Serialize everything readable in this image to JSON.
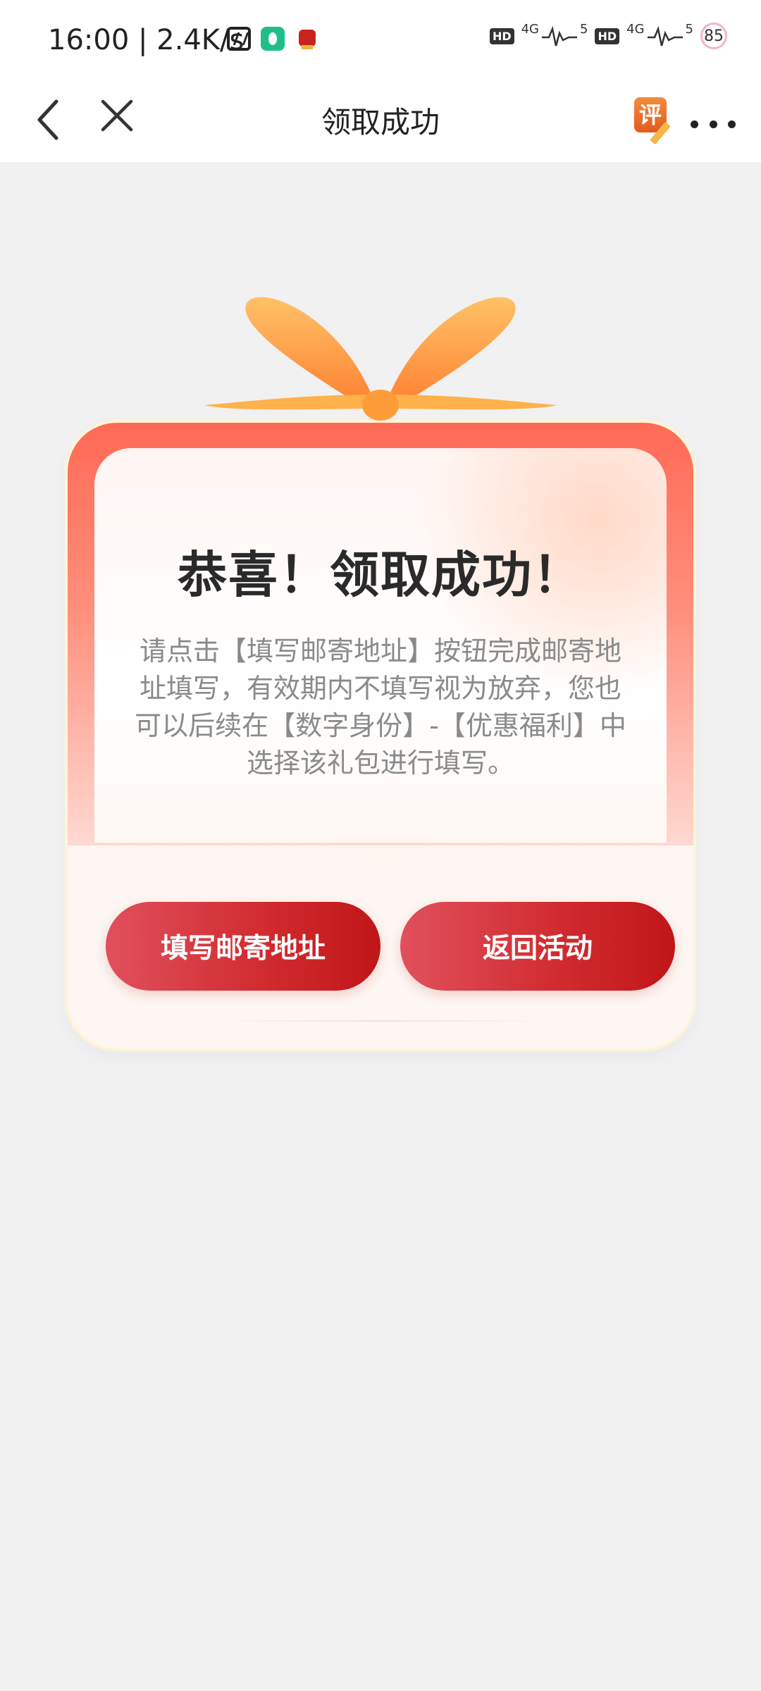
{
  "status_bar": {
    "time": "16:00 | 2.4K/s",
    "hd1": "HD",
    "signal1": "4G",
    "signal1_bars": "5",
    "hd2": "HD",
    "signal2": "4G",
    "signal2_bars": "5",
    "battery": "85"
  },
  "nav": {
    "title": "领取成功",
    "review_label": "评"
  },
  "card": {
    "title": "恭喜！领取成功！",
    "description": "请点击【填写邮寄地址】按钮完成邮寄地址填写，有效期内不填写视为放弃，您也可以后续在【数字身份】-【优惠福利】中选择该礼包进行填写。",
    "fill_address_button": "填写邮寄地址",
    "return_button": "返回活动"
  },
  "colors": {
    "button_start": "#e0505c",
    "button_end": "#c01619",
    "card_top": "#ff6a55",
    "background": "#f1f1f1"
  }
}
